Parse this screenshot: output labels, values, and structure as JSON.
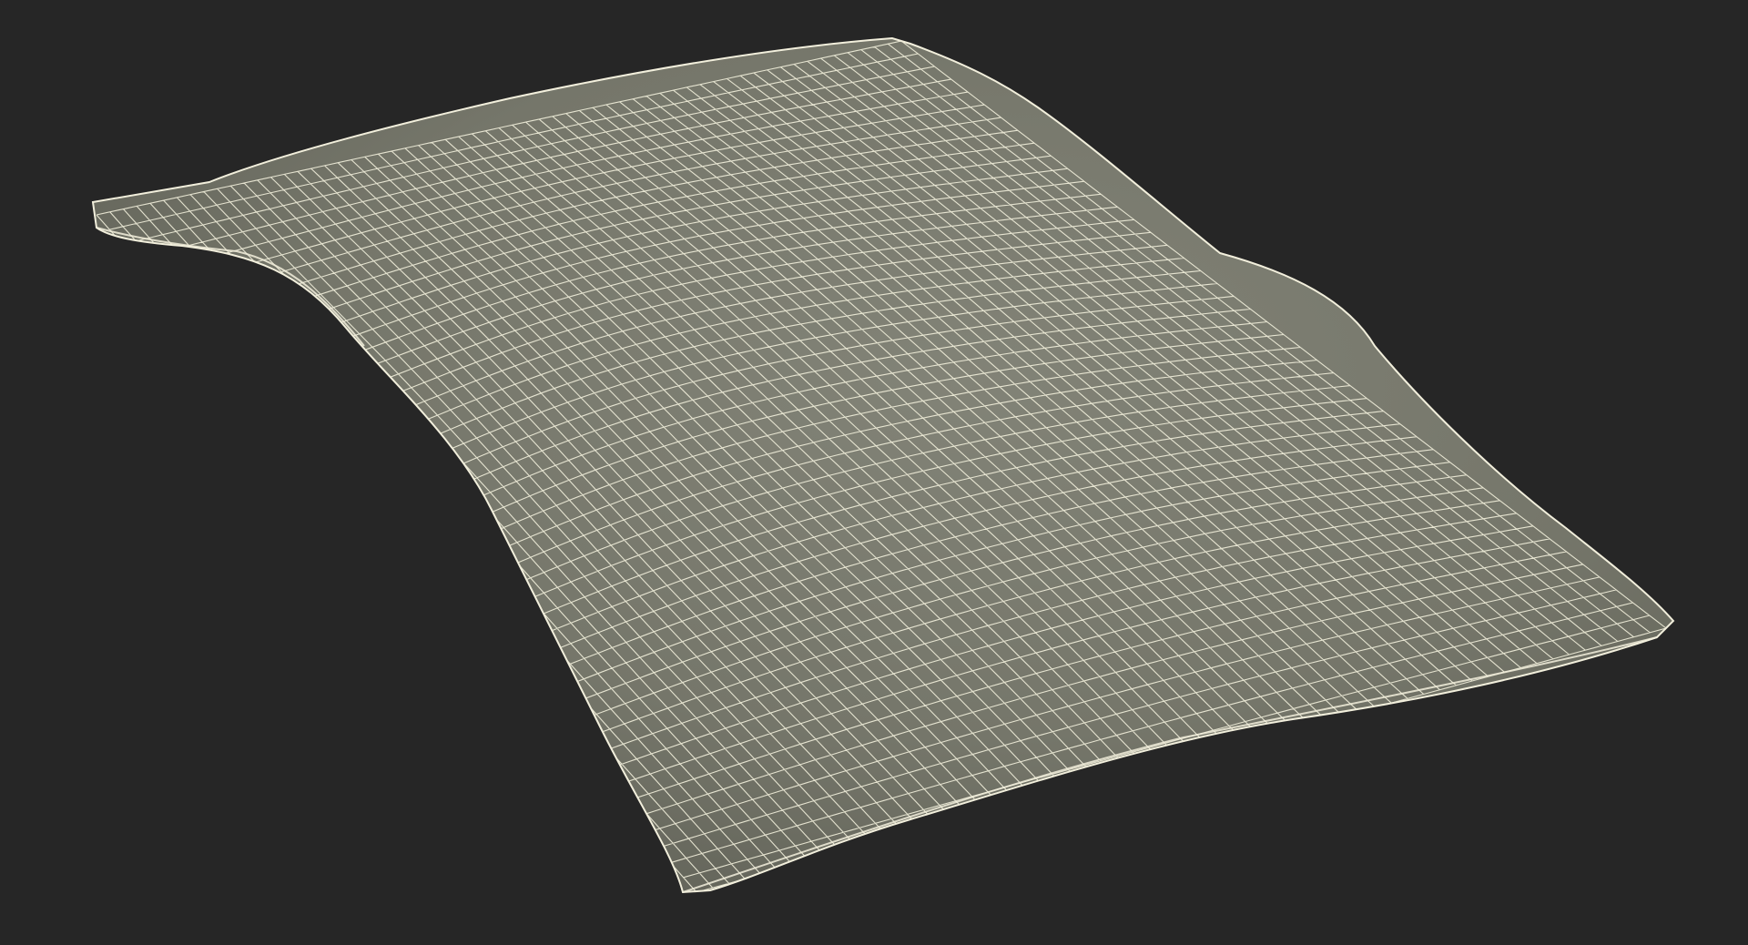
{
  "scene": {
    "background_color": "#262626",
    "object": "pillow",
    "display_mode": "wireframe",
    "surface_color": "#75766a",
    "surface_shade_color": "#5f6056",
    "surface_highlight_color": "#8a8b7e",
    "wire_color": "#f2efdc"
  }
}
